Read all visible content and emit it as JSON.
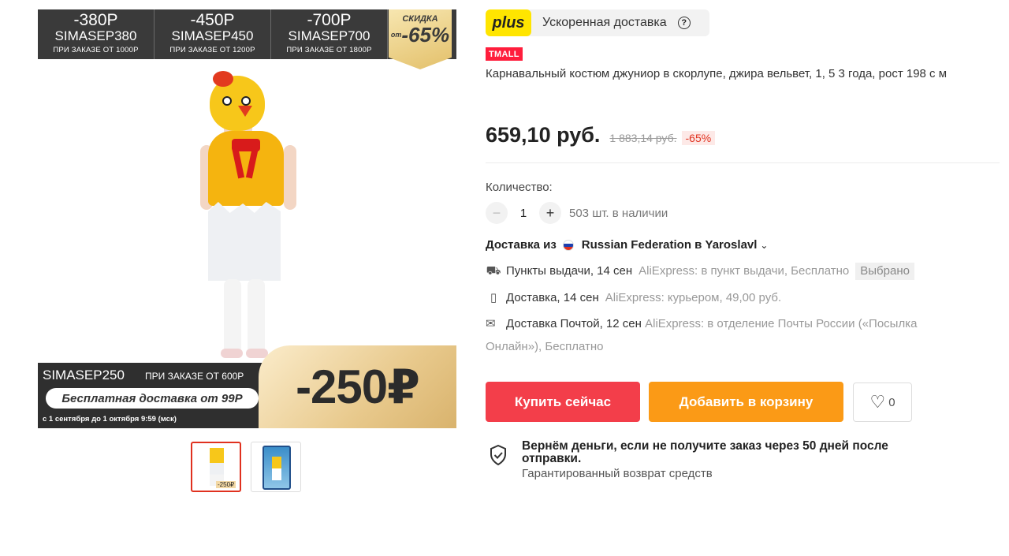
{
  "promo_top": {
    "coupons": [
      {
        "amount": "-380Р",
        "code": "SIMASEP380",
        "condition": "ПРИ ЗАКАЗЕ ОТ 1000Р"
      },
      {
        "amount": "-450Р",
        "code": "SIMASEP450",
        "condition": "ПРИ ЗАКАЗЕ ОТ 1200Р"
      },
      {
        "amount": "-700Р",
        "code": "SIMASEP700",
        "condition": "ПРИ ЗАКАЗЕ ОТ 1800Р"
      }
    ],
    "sale_label": "СКИДКА",
    "sale_prefix": "от",
    "sale_percent": "-65%"
  },
  "promo_bottom": {
    "code": "SIMASEP250",
    "condition": "ПРИ ЗАКАЗЕ ОТ 600Р",
    "free_shipping": "Бесплатная доставка от 99Р",
    "dates": "с 1 сентября до 1 октября 9:59 (мск)",
    "big_discount": "-250₽"
  },
  "thumbnails": [
    {
      "tag": "-250₽"
    },
    {
      "tag": ""
    }
  ],
  "product": {
    "plus_logo": "plus",
    "plus_text": "Ускоренная доставка",
    "tmall_badge": "TMALL",
    "title": "Карнавальный костюм джуниор в скорлупе, джира вельвет, 1, 5 3 года, рост 198 с м",
    "price": "659,10 руб.",
    "old_price": "1 883,14 руб.",
    "discount": "-65%"
  },
  "quantity": {
    "label": "Количество:",
    "minus": "−",
    "value": "1",
    "plus": "+",
    "stock": "503 шт. в наличии"
  },
  "shipping": {
    "from_prefix": "Доставка из",
    "from_place": "Russian Federation в Yaroslavl",
    "options": [
      {
        "name": "Пункты выдачи, 14 сен",
        "detail": "AliExpress: в пункт выдачи, Бесплатно",
        "badge": "Выбрано",
        "icon": "pickup-point-icon"
      },
      {
        "name": "Доставка, 14 сен",
        "detail": "AliExpress: курьером, 49,00 руб.",
        "icon": "courier-icon"
      },
      {
        "name": "Доставка Почтой, 12 сен",
        "detail": "AliExpress: в отделение Почты России («Посылка",
        "detail2": "Онлайн»), Бесплатно",
        "icon": "post-icon"
      }
    ]
  },
  "actions": {
    "buy_now": "Купить сейчас",
    "add_to_cart": "Добавить в корзину",
    "favorites_count": "0"
  },
  "guarantee": {
    "title": "Вернём деньги, если не получите заказ через 50 дней после отправки.",
    "subtitle": "Гарантированный возврат средств"
  },
  "colors": {
    "buy": "#f33e4a",
    "cart": "#fb9a16",
    "plus_yellow": "#ffe500",
    "tmall_red": "#ff1e3c"
  }
}
